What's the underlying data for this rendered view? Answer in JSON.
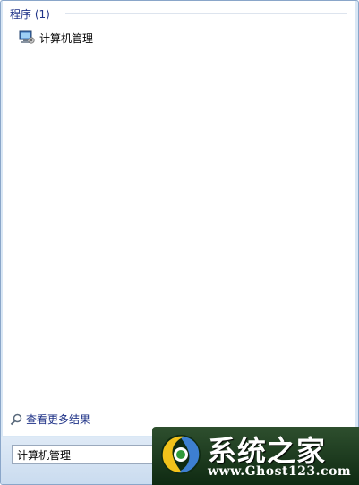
{
  "results": {
    "section_title": "程序 (1)",
    "items": [
      {
        "label": "计算机管理",
        "icon": "computer-management-icon"
      }
    ]
  },
  "more_results": {
    "label": "查看更多结果",
    "icon": "search-icon"
  },
  "search": {
    "value": "计算机管理"
  },
  "watermark": {
    "title": "系统之家",
    "url": "www.Ghost123.com"
  },
  "colors": {
    "header_text": "#1e3287",
    "panel_bg": "#d9e7f5",
    "watermark_bg": "#1a3a1c"
  }
}
